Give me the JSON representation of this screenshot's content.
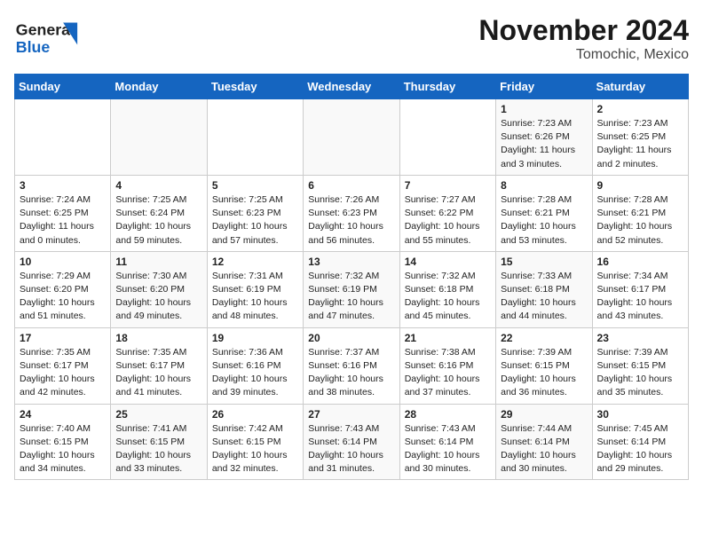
{
  "header": {
    "logo_line1": "General",
    "logo_line2": "Blue",
    "month": "November 2024",
    "location": "Tomochic, Mexico"
  },
  "days_of_week": [
    "Sunday",
    "Monday",
    "Tuesday",
    "Wednesday",
    "Thursday",
    "Friday",
    "Saturday"
  ],
  "weeks": [
    [
      {
        "day": "",
        "info": ""
      },
      {
        "day": "",
        "info": ""
      },
      {
        "day": "",
        "info": ""
      },
      {
        "day": "",
        "info": ""
      },
      {
        "day": "",
        "info": ""
      },
      {
        "day": "1",
        "info": "Sunrise: 7:23 AM\nSunset: 6:26 PM\nDaylight: 11 hours\nand 3 minutes."
      },
      {
        "day": "2",
        "info": "Sunrise: 7:23 AM\nSunset: 6:25 PM\nDaylight: 11 hours\nand 2 minutes."
      }
    ],
    [
      {
        "day": "3",
        "info": "Sunrise: 7:24 AM\nSunset: 6:25 PM\nDaylight: 11 hours\nand 0 minutes."
      },
      {
        "day": "4",
        "info": "Sunrise: 7:25 AM\nSunset: 6:24 PM\nDaylight: 10 hours\nand 59 minutes."
      },
      {
        "day": "5",
        "info": "Sunrise: 7:25 AM\nSunset: 6:23 PM\nDaylight: 10 hours\nand 57 minutes."
      },
      {
        "day": "6",
        "info": "Sunrise: 7:26 AM\nSunset: 6:23 PM\nDaylight: 10 hours\nand 56 minutes."
      },
      {
        "day": "7",
        "info": "Sunrise: 7:27 AM\nSunset: 6:22 PM\nDaylight: 10 hours\nand 55 minutes."
      },
      {
        "day": "8",
        "info": "Sunrise: 7:28 AM\nSunset: 6:21 PM\nDaylight: 10 hours\nand 53 minutes."
      },
      {
        "day": "9",
        "info": "Sunrise: 7:28 AM\nSunset: 6:21 PM\nDaylight: 10 hours\nand 52 minutes."
      }
    ],
    [
      {
        "day": "10",
        "info": "Sunrise: 7:29 AM\nSunset: 6:20 PM\nDaylight: 10 hours\nand 51 minutes."
      },
      {
        "day": "11",
        "info": "Sunrise: 7:30 AM\nSunset: 6:20 PM\nDaylight: 10 hours\nand 49 minutes."
      },
      {
        "day": "12",
        "info": "Sunrise: 7:31 AM\nSunset: 6:19 PM\nDaylight: 10 hours\nand 48 minutes."
      },
      {
        "day": "13",
        "info": "Sunrise: 7:32 AM\nSunset: 6:19 PM\nDaylight: 10 hours\nand 47 minutes."
      },
      {
        "day": "14",
        "info": "Sunrise: 7:32 AM\nSunset: 6:18 PM\nDaylight: 10 hours\nand 45 minutes."
      },
      {
        "day": "15",
        "info": "Sunrise: 7:33 AM\nSunset: 6:18 PM\nDaylight: 10 hours\nand 44 minutes."
      },
      {
        "day": "16",
        "info": "Sunrise: 7:34 AM\nSunset: 6:17 PM\nDaylight: 10 hours\nand 43 minutes."
      }
    ],
    [
      {
        "day": "17",
        "info": "Sunrise: 7:35 AM\nSunset: 6:17 PM\nDaylight: 10 hours\nand 42 minutes."
      },
      {
        "day": "18",
        "info": "Sunrise: 7:35 AM\nSunset: 6:17 PM\nDaylight: 10 hours\nand 41 minutes."
      },
      {
        "day": "19",
        "info": "Sunrise: 7:36 AM\nSunset: 6:16 PM\nDaylight: 10 hours\nand 39 minutes."
      },
      {
        "day": "20",
        "info": "Sunrise: 7:37 AM\nSunset: 6:16 PM\nDaylight: 10 hours\nand 38 minutes."
      },
      {
        "day": "21",
        "info": "Sunrise: 7:38 AM\nSunset: 6:16 PM\nDaylight: 10 hours\nand 37 minutes."
      },
      {
        "day": "22",
        "info": "Sunrise: 7:39 AM\nSunset: 6:15 PM\nDaylight: 10 hours\nand 36 minutes."
      },
      {
        "day": "23",
        "info": "Sunrise: 7:39 AM\nSunset: 6:15 PM\nDaylight: 10 hours\nand 35 minutes."
      }
    ],
    [
      {
        "day": "24",
        "info": "Sunrise: 7:40 AM\nSunset: 6:15 PM\nDaylight: 10 hours\nand 34 minutes."
      },
      {
        "day": "25",
        "info": "Sunrise: 7:41 AM\nSunset: 6:15 PM\nDaylight: 10 hours\nand 33 minutes."
      },
      {
        "day": "26",
        "info": "Sunrise: 7:42 AM\nSunset: 6:15 PM\nDaylight: 10 hours\nand 32 minutes."
      },
      {
        "day": "27",
        "info": "Sunrise: 7:43 AM\nSunset: 6:14 PM\nDaylight: 10 hours\nand 31 minutes."
      },
      {
        "day": "28",
        "info": "Sunrise: 7:43 AM\nSunset: 6:14 PM\nDaylight: 10 hours\nand 30 minutes."
      },
      {
        "day": "29",
        "info": "Sunrise: 7:44 AM\nSunset: 6:14 PM\nDaylight: 10 hours\nand 30 minutes."
      },
      {
        "day": "30",
        "info": "Sunrise: 7:45 AM\nSunset: 6:14 PM\nDaylight: 10 hours\nand 29 minutes."
      }
    ]
  ]
}
